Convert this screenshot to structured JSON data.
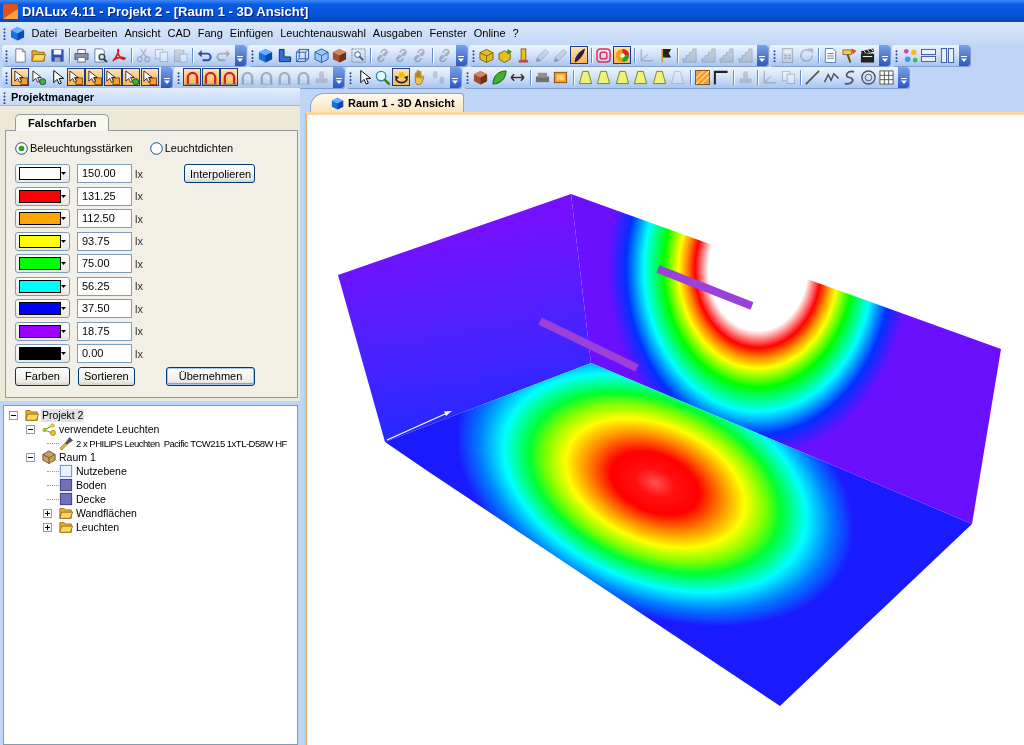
{
  "window": {
    "title": "DIALux 4.11 - Projekt 2 - [Raum 1 - 3D Ansicht]"
  },
  "menu": [
    "Datei",
    "Bearbeiten",
    "Ansicht",
    "CAD",
    "Fang",
    "Einfügen",
    "Leuchtenauswahl",
    "Ausgaben",
    "Fenster",
    "Online",
    "?"
  ],
  "toolbars": [
    {
      "groups": [
        {
          "sections": [
            [
              {
                "kind": "document",
                "pressed": false,
                "disabled": false
              },
              {
                "kind": "folder",
                "pressed": false,
                "disabled": false
              },
              {
                "kind": "floppy",
                "pressed": false,
                "disabled": false
              }
            ],
            [
              {
                "kind": "printer",
                "pressed": false,
                "disabled": false
              },
              {
                "kind": "preview",
                "pressed": false,
                "disabled": false
              },
              {
                "kind": "pdf",
                "pressed": false,
                "disabled": false
              }
            ],
            [
              {
                "kind": "scissors",
                "pressed": false,
                "disabled": true
              },
              {
                "kind": "copy",
                "pressed": false,
                "disabled": true
              },
              {
                "kind": "paste",
                "pressed": false,
                "disabled": true
              }
            ],
            [
              {
                "kind": "undo",
                "pressed": false,
                "disabled": false
              },
              {
                "kind": "redo",
                "pressed": false,
                "disabled": true
              }
            ]
          ]
        },
        {
          "sections": [
            [
              {
                "kind": "cube",
                "pressed": false,
                "disabled": false
              },
              {
                "kind": "lshape",
                "pressed": false,
                "disabled": false
              },
              {
                "kind": "wirecube",
                "pressed": false,
                "disabled": false
              },
              {
                "kind": "glasscube",
                "pressed": false,
                "disabled": false
              },
              {
                "kind": "brick",
                "pressed": false,
                "disabled": false
              },
              {
                "kind": "zoombox",
                "pressed": false,
                "disabled": false
              }
            ],
            [
              {
                "kind": "link",
                "pressed": false,
                "disabled": true
              },
              {
                "kind": "link",
                "pressed": false,
                "disabled": true
              },
              {
                "kind": "link",
                "pressed": false,
                "disabled": true
              }
            ],
            [
              {
                "kind": "link",
                "pressed": false,
                "disabled": true
              }
            ]
          ]
        },
        {
          "sections": [
            [
              {
                "kind": "box3d",
                "pressed": false,
                "disabled": false
              },
              {
                "kind": "boxarrow",
                "pressed": false,
                "disabled": false
              },
              {
                "kind": "column",
                "pressed": false,
                "disabled": false
              },
              {
                "kind": "pencil",
                "pressed": false,
                "disabled": true
              },
              {
                "kind": "pencil",
                "pressed": false,
                "disabled": true
              },
              {
                "kind": "brush",
                "pressed": true,
                "disabled": false
              }
            ],
            [
              {
                "kind": "target",
                "pressed": false,
                "disabled": false
              },
              {
                "kind": "colorwheel",
                "pressed": true,
                "disabled": false
              }
            ],
            [
              {
                "kind": "axes",
                "pressed": false,
                "disabled": true
              },
              {
                "kind": "flag",
                "pressed": false,
                "disabled": false
              }
            ],
            [
              {
                "kind": "stairs",
                "pressed": false,
                "disabled": true
              },
              {
                "kind": "stairs",
                "pressed": false,
                "disabled": true
              },
              {
                "kind": "stairs",
                "pressed": false,
                "disabled": true
              },
              {
                "kind": "stairs",
                "pressed": false,
                "disabled": true
              }
            ]
          ]
        },
        {
          "sections": [
            [
              {
                "kind": "calculator",
                "pressed": false,
                "disabled": true
              },
              {
                "kind": "refresh",
                "pressed": false,
                "disabled": true
              }
            ],
            [
              {
                "kind": "report",
                "pressed": false,
                "disabled": false
              },
              {
                "kind": "paintbrush",
                "pressed": false,
                "disabled": false
              },
              {
                "kind": "clapper",
                "pressed": false,
                "disabled": false
              }
            ]
          ]
        },
        {
          "sections": [
            [
              {
                "kind": "sparkle",
                "pressed": false,
                "disabled": false
              },
              {
                "kind": "rows",
                "pressed": false,
                "disabled": false
              },
              {
                "kind": "columns",
                "pressed": false,
                "disabled": false
              }
            ]
          ]
        }
      ]
    },
    {
      "groups": [
        {
          "sections": [
            [
              {
                "kind": "select",
                "pressed": true,
                "disabled": false
              },
              {
                "kind": "pick",
                "pressed": false,
                "disabled": false
              },
              {
                "kind": "cursor",
                "pressed": false,
                "disabled": false
              },
              {
                "kind": "select",
                "pressed": true,
                "disabled": false
              },
              {
                "kind": "select",
                "pressed": true,
                "disabled": false
              },
              {
                "kind": "select",
                "pressed": true,
                "disabled": false
              },
              {
                "kind": "pick",
                "pressed": true,
                "disabled": false
              },
              {
                "kind": "select",
                "pressed": true,
                "disabled": false
              }
            ]
          ]
        },
        {
          "sections": [
            [
              {
                "kind": "snap",
                "pressed": true,
                "disabled": false
              },
              {
                "kind": "snap",
                "pressed": true,
                "disabled": false
              },
              {
                "kind": "snap",
                "pressed": true,
                "disabled": false
              },
              {
                "kind": "snap",
                "pressed": false,
                "disabled": true
              },
              {
                "kind": "snap",
                "pressed": false,
                "disabled": true
              },
              {
                "kind": "snap",
                "pressed": false,
                "disabled": true
              },
              {
                "kind": "snap",
                "pressed": false,
                "disabled": true
              },
              {
                "kind": "stamp",
                "pressed": false,
                "disabled": true
              }
            ]
          ]
        },
        {
          "sections": [
            [
              {
                "kind": "cursor",
                "pressed": false,
                "disabled": false
              },
              {
                "kind": "zoom",
                "pressed": false,
                "disabled": false
              },
              {
                "kind": "orbit",
                "pressed": true,
                "disabled": false
              },
              {
                "kind": "hand",
                "pressed": false,
                "disabled": false
              },
              {
                "kind": "walk",
                "pressed": false,
                "disabled": true
              }
            ]
          ]
        },
        {
          "sections": [
            [
              {
                "kind": "brick",
                "pressed": false,
                "disabled": false
              },
              {
                "kind": "leaf",
                "pressed": false,
                "disabled": false
              },
              {
                "kind": "arrows",
                "pressed": false,
                "disabled": false
              }
            ],
            [
              {
                "kind": "sofa",
                "pressed": false,
                "disabled": false
              },
              {
                "kind": "window",
                "pressed": false,
                "disabled": false
              }
            ],
            [
              {
                "kind": "shape",
                "pressed": false,
                "disabled": false
              },
              {
                "kind": "shape",
                "pressed": false,
                "disabled": false
              },
              {
                "kind": "shape",
                "pressed": false,
                "disabled": false
              },
              {
                "kind": "shape",
                "pressed": false,
                "disabled": false
              },
              {
                "kind": "shape",
                "pressed": false,
                "disabled": false
              },
              {
                "kind": "shape",
                "pressed": false,
                "disabled": true
              }
            ],
            [
              {
                "kind": "hatch",
                "pressed": false,
                "disabled": false
              },
              {
                "kind": "frame",
                "pressed": false,
                "disabled": false
              }
            ],
            [
              {
                "kind": "stamp",
                "pressed": false,
                "disabled": true
              }
            ],
            [
              {
                "kind": "axes",
                "pressed": false,
                "disabled": true
              },
              {
                "kind": "copy",
                "pressed": false,
                "disabled": true
              }
            ],
            [
              {
                "kind": "line",
                "pressed": false,
                "disabled": false
              },
              {
                "kind": "wave",
                "pressed": false,
                "disabled": false
              },
              {
                "kind": "curve",
                "pressed": false,
                "disabled": false
              },
              {
                "kind": "circle",
                "pressed": false,
                "disabled": false
              },
              {
                "kind": "grid",
                "pressed": false,
                "disabled": false
              }
            ]
          ]
        }
      ]
    }
  ],
  "project_manager": {
    "title": "Projektmanager",
    "tabs": [
      {
        "label": "Falschfarben",
        "selected": true
      }
    ],
    "modes": [
      {
        "label": "Beleuchtungsstärken",
        "selected": true
      },
      {
        "label": "Leuchtdichten",
        "selected": false
      }
    ],
    "levels": [
      {
        "color": "#ffffff",
        "value": "150.00",
        "unit": "lx"
      },
      {
        "color": "#ff0000",
        "value": "131.25",
        "unit": "lx"
      },
      {
        "color": "#ffa500",
        "value": "112.50",
        "unit": "lx"
      },
      {
        "color": "#ffff00",
        "value": "93.75",
        "unit": "lx"
      },
      {
        "color": "#00ff00",
        "value": "75.00",
        "unit": "lx"
      },
      {
        "color": "#00ffff",
        "value": "56.25",
        "unit": "lx"
      },
      {
        "color": "#0000ff",
        "value": "37.50",
        "unit": "lx"
      },
      {
        "color": "#9900ff",
        "value": "18.75",
        "unit": "lx"
      },
      {
        "color": "#000000",
        "value": "0.00",
        "unit": "lx"
      }
    ],
    "interpolate": "Interpolieren",
    "buttons": [
      {
        "label": "Farben",
        "default": false
      },
      {
        "label": "Sortieren",
        "default": false
      },
      {
        "label": "Übernehmen",
        "default": true
      }
    ]
  },
  "tree": [
    {
      "label": "Projekt 2",
      "kind": "folder",
      "selected": true,
      "expanded": true,
      "children": [
        {
          "label": "verwendete Leuchten",
          "kind": "nodes",
          "selected": false,
          "expanded": true,
          "children": [
            {
              "label": "2 x PHILIPS Leuchten  Pacific TCW215 1xTL-D58W HF",
              "kind": "luminaire",
              "selected": false
            }
          ]
        },
        {
          "label": "Raum 1",
          "kind": "room",
          "selected": false,
          "expanded": true,
          "children": [
            {
              "label": "Nutzebene",
              "kind": "plane",
              "selected": false
            },
            {
              "label": "Boden",
              "kind": "surface",
              "selected": false
            },
            {
              "label": "Decke",
              "kind": "surface",
              "selected": false
            },
            {
              "label": "Wandflächen",
              "kind": "folder",
              "selected": false,
              "expanded": false
            },
            {
              "label": "Leuchten",
              "kind": "folder",
              "selected": false,
              "expanded": false
            }
          ]
        }
      ]
    }
  ],
  "view_tabs": [
    {
      "label": "Raum 1 - 3D Ansicht",
      "selected": true
    }
  ]
}
